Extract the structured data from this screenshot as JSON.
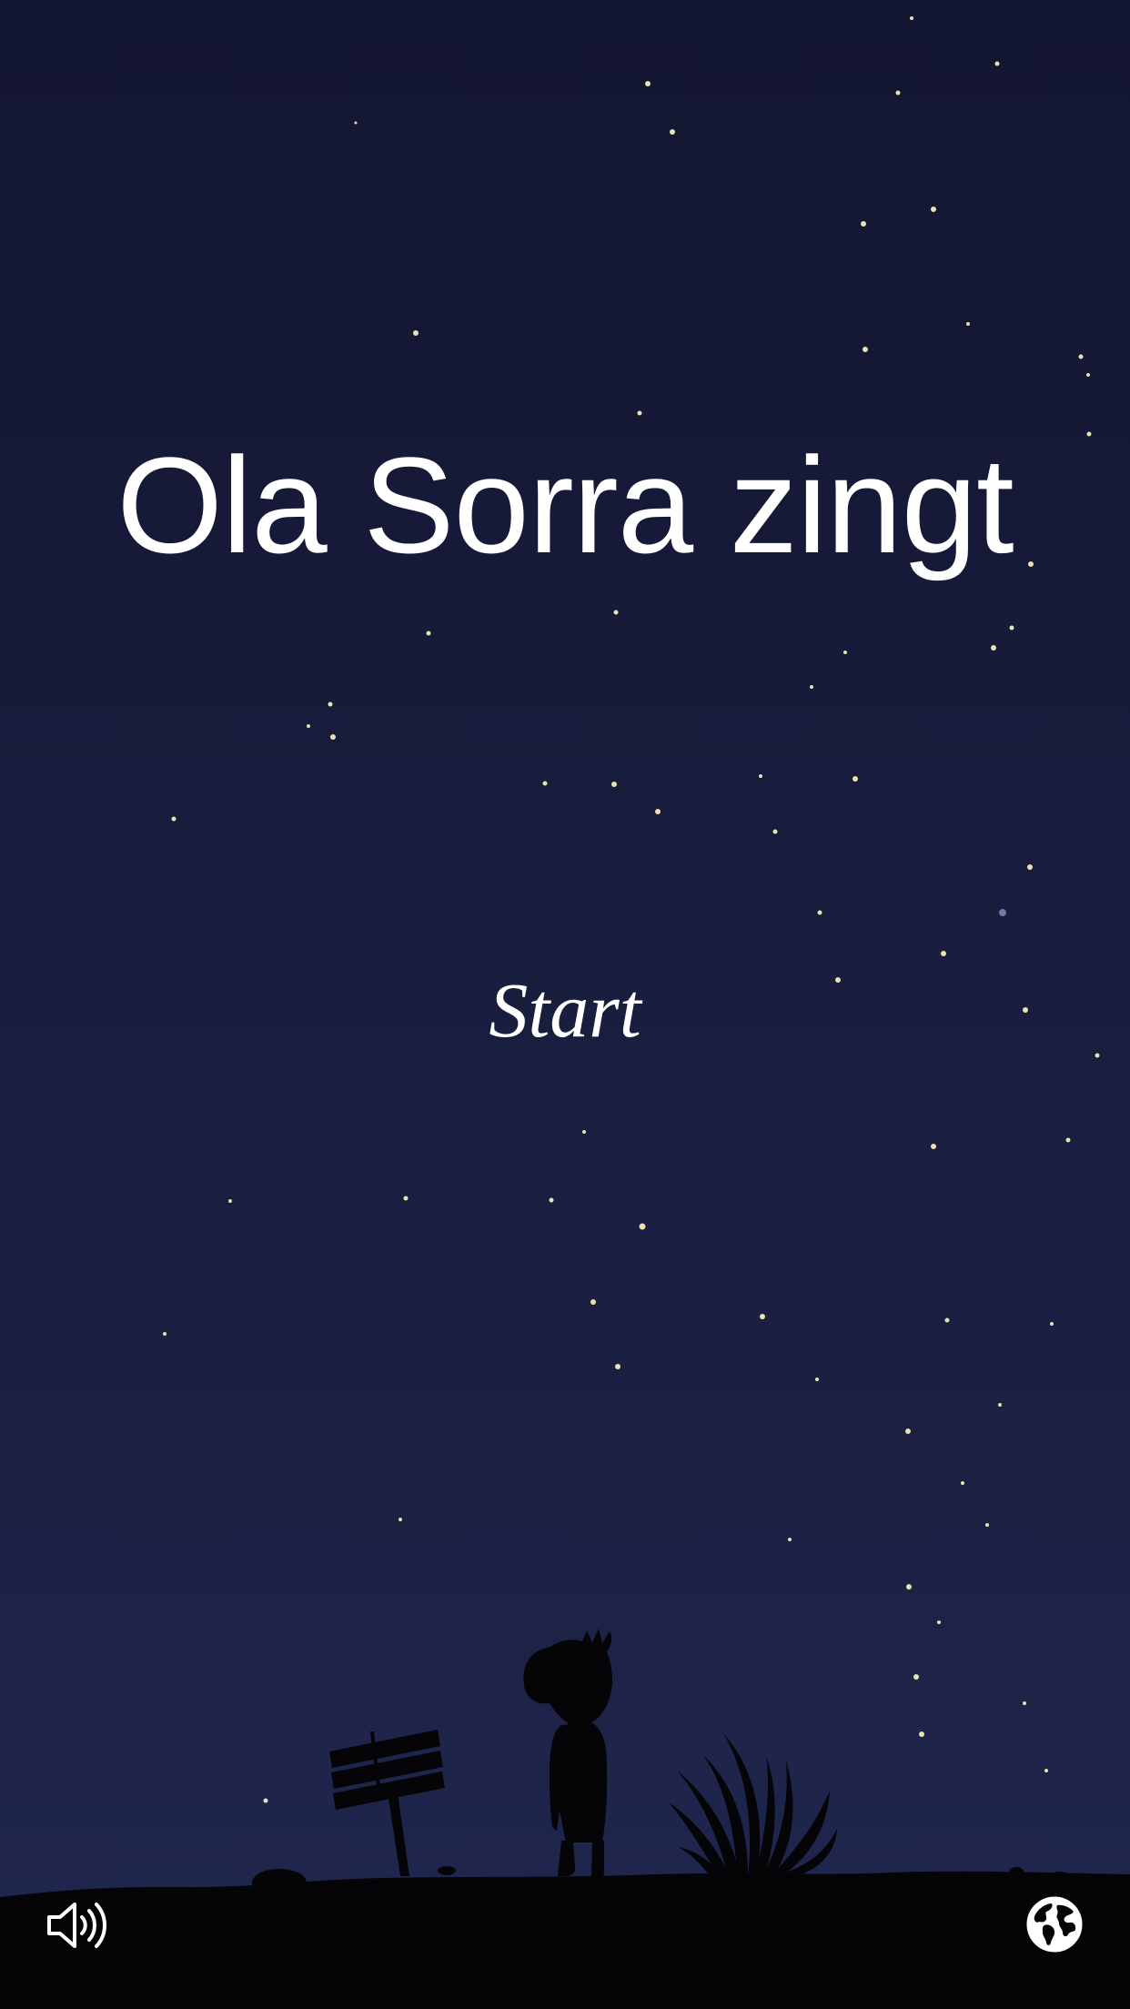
{
  "game": {
    "title": "Ola Sorra zingt",
    "start_label": "Start"
  },
  "controls": {
    "sound_icon": "speaker-volume-icon",
    "language_icon": "globe-icon"
  },
  "colors": {
    "sky_top": "#131630",
    "sky_bottom": "#202750",
    "text": "#ffffff",
    "silhouette": "#050507"
  }
}
